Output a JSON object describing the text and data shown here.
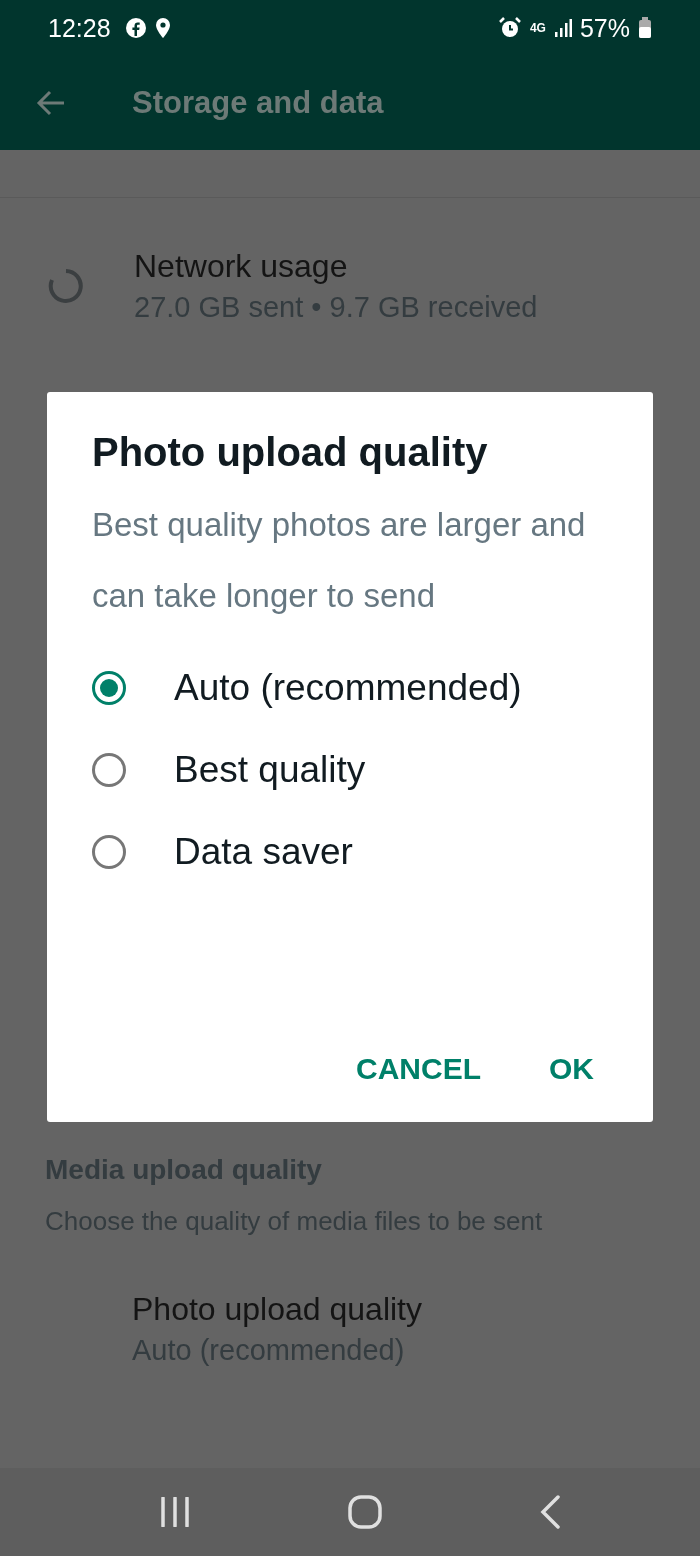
{
  "status_bar": {
    "time": "12:28",
    "network": "4G",
    "battery": "57%"
  },
  "app_bar": {
    "title": "Storage and data"
  },
  "network_usage": {
    "title": "Network usage",
    "subtitle": "27.0 GB sent • 9.7 GB received"
  },
  "media_section": {
    "header": "Media upload quality",
    "description": "Choose the quality of media files to be sent",
    "setting": {
      "title": "Photo upload quality",
      "value": "Auto (recommended)"
    }
  },
  "dialog": {
    "title": "Photo upload quality",
    "message": "Best quality photos are larger and can take longer to send",
    "options": [
      {
        "label": "Auto (recommended)",
        "selected": true
      },
      {
        "label": "Best quality",
        "selected": false
      },
      {
        "label": "Data saver",
        "selected": false
      }
    ],
    "buttons": [
      {
        "label": "CANCEL"
      },
      {
        "label": "OK"
      }
    ]
  }
}
